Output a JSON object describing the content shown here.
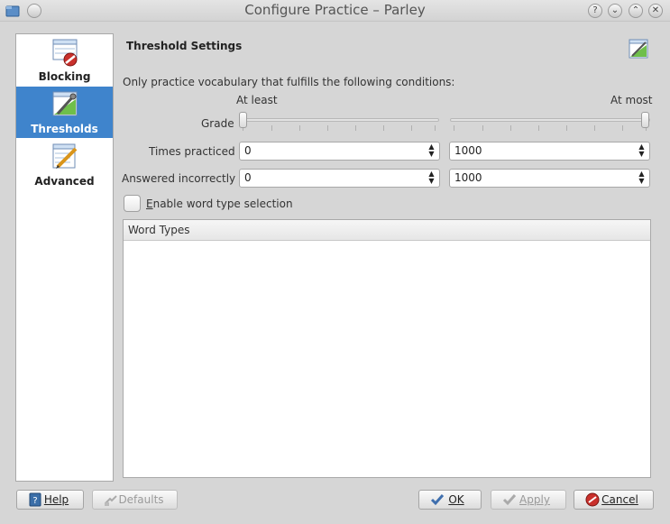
{
  "window": {
    "title": "Configure Practice – Parley",
    "controls": [
      "help-icon",
      "minimize-icon",
      "maximize-icon",
      "close-icon"
    ]
  },
  "sidebar": {
    "items": [
      {
        "label": "Blocking",
        "icon": "blocking-icon",
        "selected": false
      },
      {
        "label": "Thresholds",
        "icon": "thresholds-icon",
        "selected": true
      },
      {
        "label": "Advanced",
        "icon": "advanced-icon",
        "selected": false
      }
    ]
  },
  "page": {
    "heading": "Threshold Settings",
    "intro": "Only practice vocabulary that fulfills the following conditions:",
    "at_least": "At least",
    "at_most": "At most",
    "grade": {
      "label": "Grade",
      "min_value": 0,
      "max_value": 1
    },
    "times_practiced": {
      "label": "Times practiced",
      "min": "0",
      "max": "1000"
    },
    "answered_incorrectly": {
      "label": "Answered incorrectly",
      "min": "0",
      "max": "1000"
    },
    "word_type": {
      "checkbox_label_first": "E",
      "checkbox_label_rest": "nable word type selection",
      "checked": false
    },
    "list": {
      "header": "Word Types",
      "items": []
    }
  },
  "buttons": {
    "help": "Help",
    "defaults": "Defaults",
    "ok": "OK",
    "apply": "Apply",
    "cancel": "Cancel"
  },
  "colors": {
    "selection": "#3f84cc",
    "window_bg": "#d6d6d6"
  }
}
